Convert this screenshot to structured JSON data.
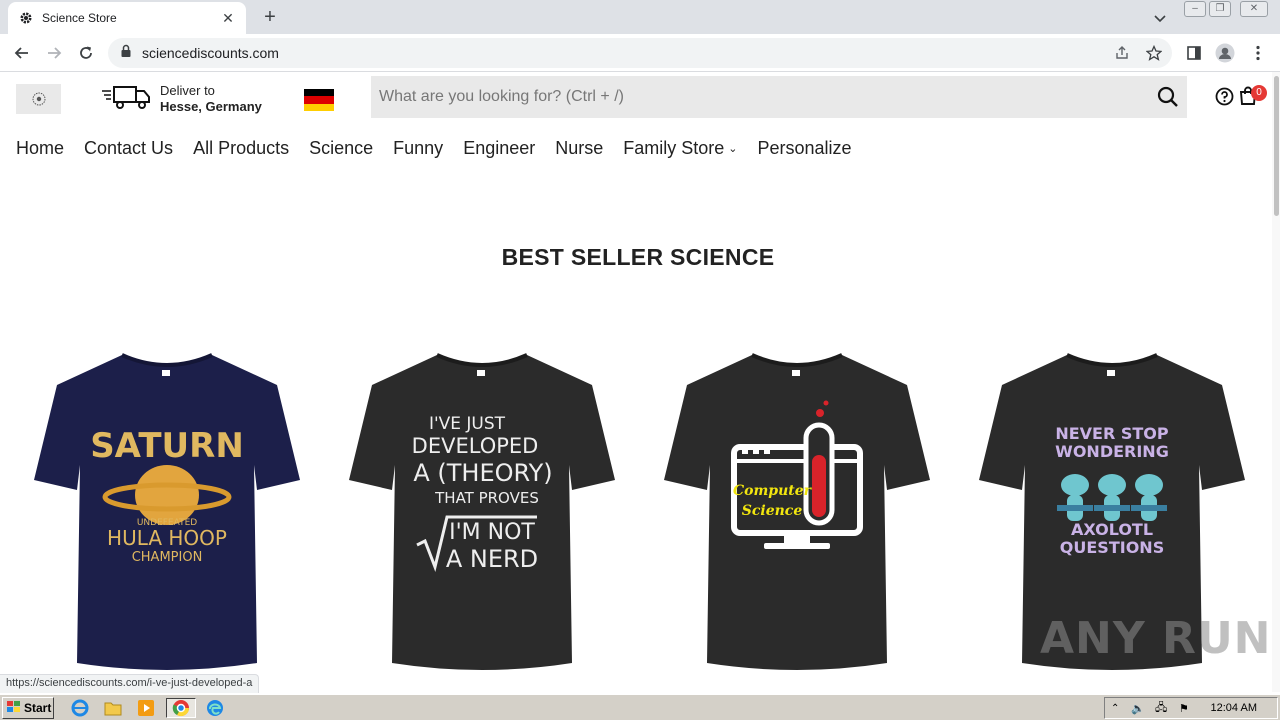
{
  "browser": {
    "tab_title": "Science Store",
    "url": "sciencediscounts.com",
    "status_url": "https://sciencediscounts.com/i-ve-just-developed-a"
  },
  "header": {
    "deliver_label": "Deliver to",
    "deliver_location": "Hesse, Germany",
    "search_placeholder": "What are you looking for? (Ctrl + /)",
    "cart_count": "0"
  },
  "nav": {
    "items": [
      {
        "label": "Home"
      },
      {
        "label": "Contact Us"
      },
      {
        "label": "All Products"
      },
      {
        "label": "Science"
      },
      {
        "label": "Funny"
      },
      {
        "label": "Engineer"
      },
      {
        "label": "Nurse"
      },
      {
        "label": "Family Store"
      },
      {
        "label": "Personalize"
      }
    ]
  },
  "section": {
    "title": "BEST SELLER SCIENCE"
  },
  "products": [
    {
      "shirt_color": "#1c1f4a",
      "print_lines": [
        "SATURN",
        "UNDEFEATED",
        "HULA HOOP",
        "CHAMPION"
      ]
    },
    {
      "shirt_color": "#2b2b2b",
      "print_lines": [
        "I'VE JUST",
        "DEVELOPED",
        "A (THEORY)",
        "THAT PROVES",
        "I'M NOT",
        "A NERD"
      ]
    },
    {
      "shirt_color": "#2b2b2b",
      "print_lines": [
        "Computer",
        "Science"
      ]
    },
    {
      "shirt_color": "#2b2b2b",
      "print_lines": [
        "NEVER STOP",
        "WONDERING",
        "AXOLOTL",
        "QUESTIONS"
      ]
    }
  ],
  "watermark": "ANY RUN",
  "taskbar": {
    "start_label": "Start",
    "time": "12:04 AM"
  },
  "colors": {
    "flag_black": "#000000",
    "flag_red": "#dd0000",
    "flag_gold": "#ffce00",
    "badge_red": "#e53935"
  }
}
